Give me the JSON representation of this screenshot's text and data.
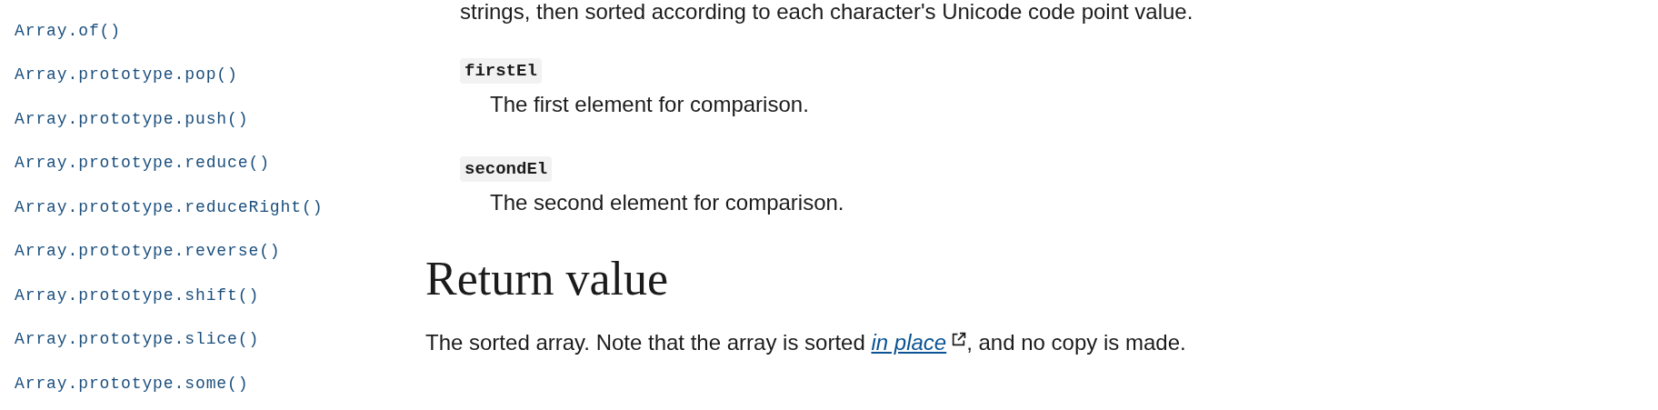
{
  "sidebar": {
    "items": [
      {
        "label": "Array.of()"
      },
      {
        "label": "Array.prototype.pop()"
      },
      {
        "label": "Array.prototype.push()"
      },
      {
        "label": "Array.prototype.reduce()"
      },
      {
        "label": "Array.prototype.reduceRight()"
      },
      {
        "label": "Array.prototype.reverse()"
      },
      {
        "label": "Array.prototype.shift()"
      },
      {
        "label": "Array.prototype.slice()"
      },
      {
        "label": "Array.prototype.some()"
      }
    ]
  },
  "content": {
    "intro_tail": "strings, then sorted according to each character's Unicode code point value.",
    "parameters": [
      {
        "name": "firstEl",
        "description": "The first element for comparison."
      },
      {
        "name": "secondEl",
        "description": "The second element for comparison."
      }
    ],
    "return_heading": "Return value",
    "return_text": {
      "before": "The sorted array. Note that the array is sorted ",
      "link": "in place",
      "after": ", and no copy is made."
    }
  }
}
